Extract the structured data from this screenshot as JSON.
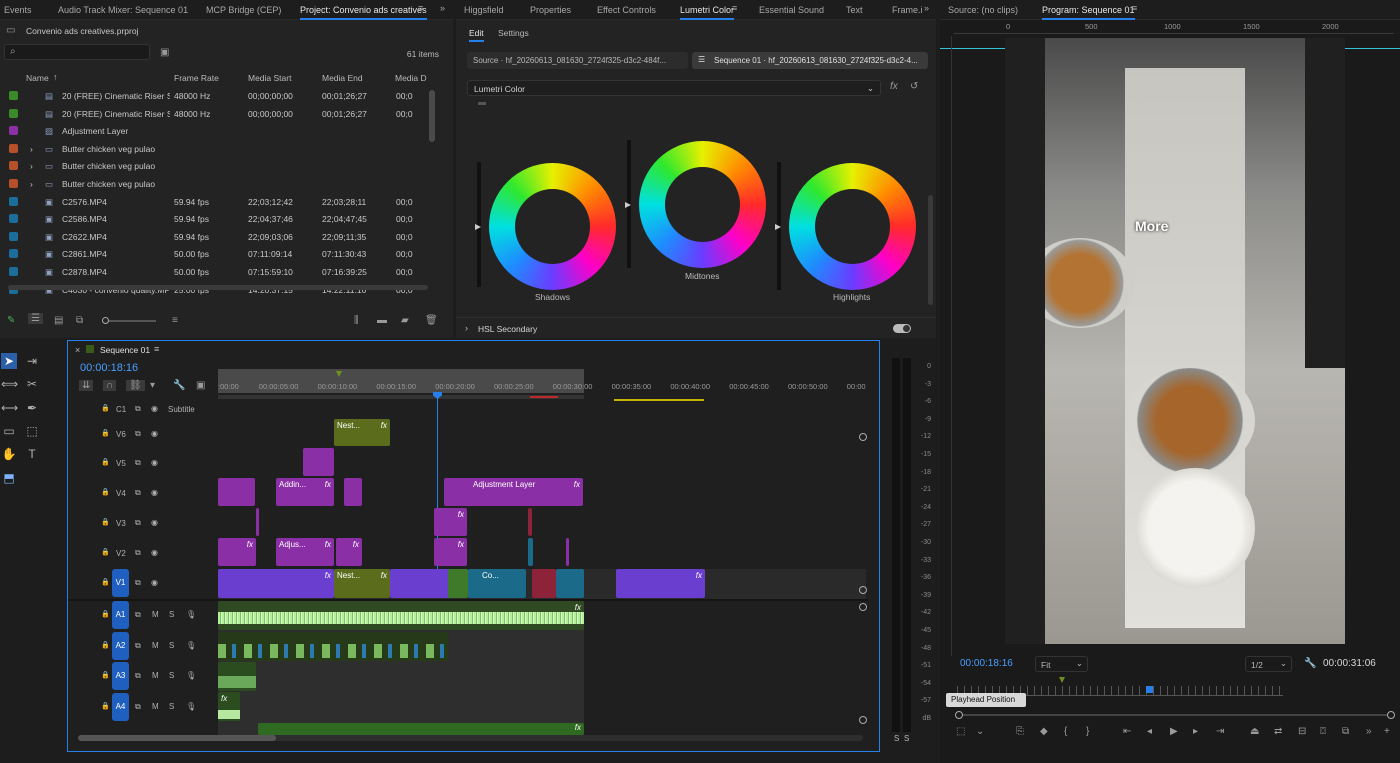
{
  "top_tabs_left": [
    "Events",
    "Audio Track Mixer: Sequence 01",
    "MCP Bridge (CEP)",
    "Project: Convenio ads creatives"
  ],
  "top_tabs_mid": [
    "Higgsfield",
    "Properties",
    "Effect Controls",
    "Lumetri Color",
    "Essential Sound",
    "Text",
    "Frame.i"
  ],
  "top_tabs_right": [
    "Source: (no clips)",
    "Program: Sequence 01"
  ],
  "project": {
    "file": "Convenio ads creatives.prproj",
    "count": "61 items",
    "columns": [
      "Name",
      "Frame Rate",
      "Media Start",
      "Media End",
      "Media D"
    ],
    "rows": [
      {
        "name": "20 (FREE) Cinematic Riser SF",
        "rate": "48000 Hz",
        "start": "00;00;00;00",
        "end": "00;01;26;27",
        "dur": "00;0",
        "color": "#3a8a2a"
      },
      {
        "name": "20 (FREE) Cinematic Riser SF",
        "rate": "48000 Hz",
        "start": "00;00;00;00",
        "end": "00;01;26;27",
        "dur": "00;0",
        "color": "#3a8a2a"
      },
      {
        "name": "Adjustment Layer",
        "rate": "",
        "start": "",
        "end": "",
        "dur": "",
        "color": "#8e2fa8"
      },
      {
        "name": "Butter chicken veg pulao",
        "rate": "",
        "start": "",
        "end": "",
        "dur": "",
        "color": "#b5502a"
      },
      {
        "name": "Butter chicken veg pulao",
        "rate": "",
        "start": "",
        "end": "",
        "dur": "",
        "color": "#b5502a"
      },
      {
        "name": "Butter chicken veg pulao",
        "rate": "",
        "start": "",
        "end": "",
        "dur": "",
        "color": "#b5502a"
      },
      {
        "name": "C2576.MP4",
        "rate": "59.94 fps",
        "start": "22;03;12;42",
        "end": "22;03;28;11",
        "dur": "00;0",
        "color": "#1c6e9a"
      },
      {
        "name": "C2586.MP4",
        "rate": "59.94 fps",
        "start": "22;04;37;46",
        "end": "22;04;47;45",
        "dur": "00;0",
        "color": "#1c6e9a"
      },
      {
        "name": "C2622.MP4",
        "rate": "59.94 fps",
        "start": "22;09;03;06",
        "end": "22;09;11;35",
        "dur": "00;0",
        "color": "#1c6e9a"
      },
      {
        "name": "C2861.MP4",
        "rate": "50.00 fps",
        "start": "07:11:09:14",
        "end": "07:11:30:43",
        "dur": "00;0",
        "color": "#1c6e9a"
      },
      {
        "name": "C2878.MP4",
        "rate": "50.00 fps",
        "start": "07:15:59:10",
        "end": "07:16:39:25",
        "dur": "00;0",
        "color": "#1c6e9a"
      },
      {
        "name": "C4030 - convenio quality.MP",
        "rate": "25.00 fps",
        "start": "14:20:37:15",
        "end": "14:22:11:16",
        "dur": "00;0",
        "color": "#1c6e9a"
      }
    ]
  },
  "lumetri": {
    "subtabs": [
      "Edit",
      "Settings"
    ],
    "source": "Source · hf_20260613_081630_2724f325-d3c2-484f...",
    "sequence": "Sequence 01 · hf_20260613_081630_2724f325-d3c2-4...",
    "effect": "Lumetri Color",
    "wheels": [
      "Shadows",
      "Midtones",
      "Highlights"
    ],
    "section": "HSL Secondary"
  },
  "timeline": {
    "name": "Sequence 01",
    "timecode": "00:00:18:16",
    "ruler": [
      ":00:00",
      "00:00:05:00",
      "00:00:10:00",
      "00:00:15:00",
      "00:00:20:00",
      "00:00:25:00",
      "00:00:30:00",
      "00:00:35:00",
      "00:00:40:00",
      "00:00:45:00",
      "00:00:50:00",
      "00:00"
    ],
    "video_tracks": [
      "C1",
      "V6",
      "V5",
      "V4",
      "V3",
      "V2",
      "V1"
    ],
    "audio_tracks": [
      "A1",
      "A2",
      "A3",
      "A4"
    ],
    "subtitle": "Subtitle",
    "clip_labels": {
      "nest1": "Nest...",
      "adding": "Addin...",
      "adjust_layer": "Adjustment Layer",
      "adjus": "Adjus...",
      "nest2": "Nest...",
      "co": "Co..."
    },
    "fx": "fx"
  },
  "meter_scale": [
    "0",
    "-3",
    "-6",
    "-9",
    "-12",
    "-15",
    "-18",
    "-21",
    "-24",
    "-27",
    "-30",
    "-33",
    "-36",
    "-39",
    "-42",
    "-45",
    "-48",
    "-51",
    "-54",
    "-57",
    "dB"
  ],
  "meter_footer": [
    "S",
    "S"
  ],
  "program": {
    "overlay_text": "More",
    "ruler_ticks": [
      "0",
      "500",
      "1000",
      "1500",
      "2000"
    ],
    "timecode": "00:00:18:16",
    "fit": "Fit",
    "resolution": "1/2",
    "duration": "00:00:31:06",
    "tooltip": "Playhead Position"
  },
  "colors": {
    "accent": "#2680eb",
    "purple": "#8a2fa5",
    "olive": "#5b6d1c",
    "teal": "#1b6a8a"
  }
}
